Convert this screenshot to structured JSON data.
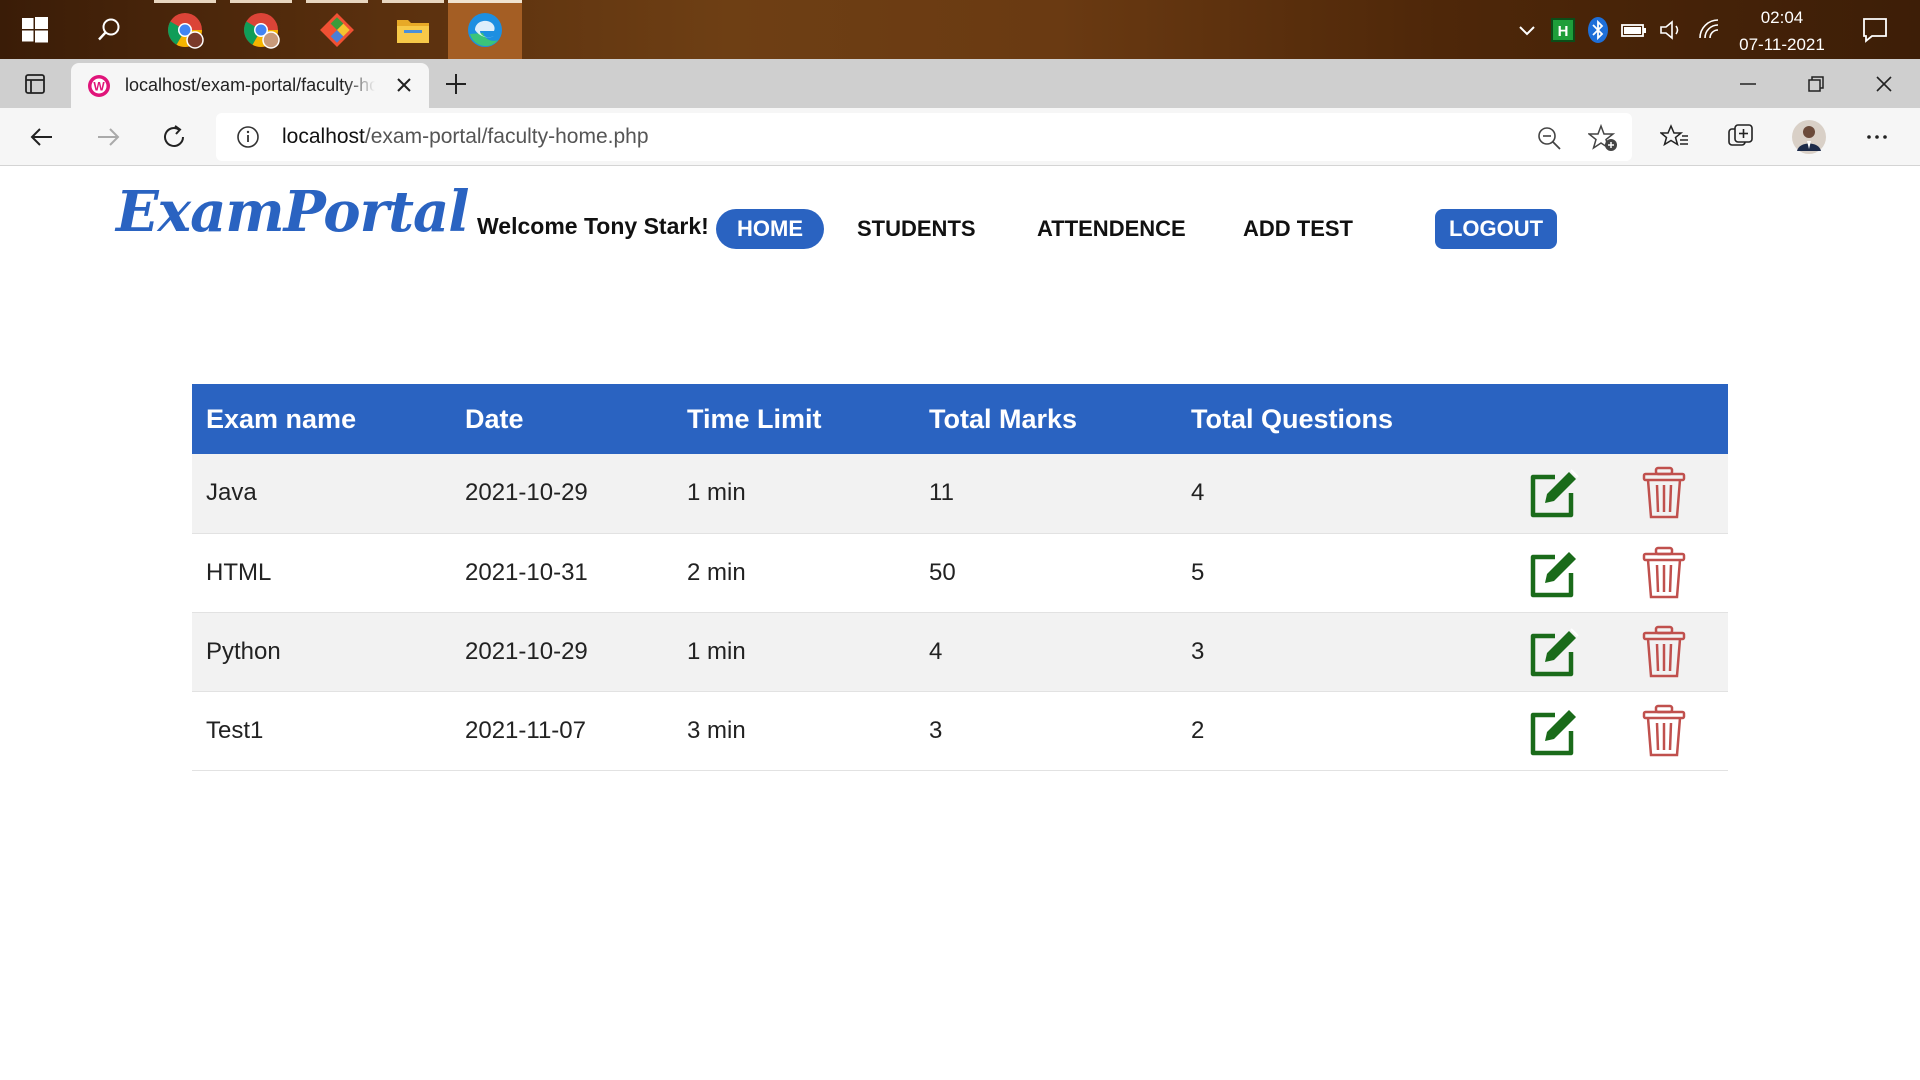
{
  "taskbar": {
    "time": "02:04",
    "date": "07-11-2021"
  },
  "browser": {
    "tab_title": "localhost/exam-portal/faculty-home.php",
    "url_host": "localhost",
    "url_path": "/exam-portal/faculty-home.php"
  },
  "page": {
    "logo": "ExamPortal",
    "welcome": "Welcome Tony Stark!",
    "nav": {
      "home": "HOME",
      "students": "STUDENTS",
      "attendence": "ATTENDENCE",
      "add_test": "ADD TEST",
      "logout": "LOGOUT"
    },
    "table": {
      "headers": [
        "Exam name",
        "Date",
        "Time Limit",
        "Total Marks",
        "Total Questions"
      ],
      "rows": [
        [
          "Java",
          "2021-10-29",
          "1 min",
          "11",
          "4"
        ],
        [
          "HTML",
          "2021-10-31",
          "2 min",
          "50",
          "5"
        ],
        [
          "Python",
          "2021-10-29",
          "1 min",
          "4",
          "3"
        ],
        [
          "Test1",
          "2021-11-07",
          "3 min",
          "3",
          "2"
        ]
      ]
    }
  },
  "colors": {
    "brand": "#2a63c1",
    "edit_icon": "#1a6b1a",
    "delete_icon": "#c0504d"
  }
}
